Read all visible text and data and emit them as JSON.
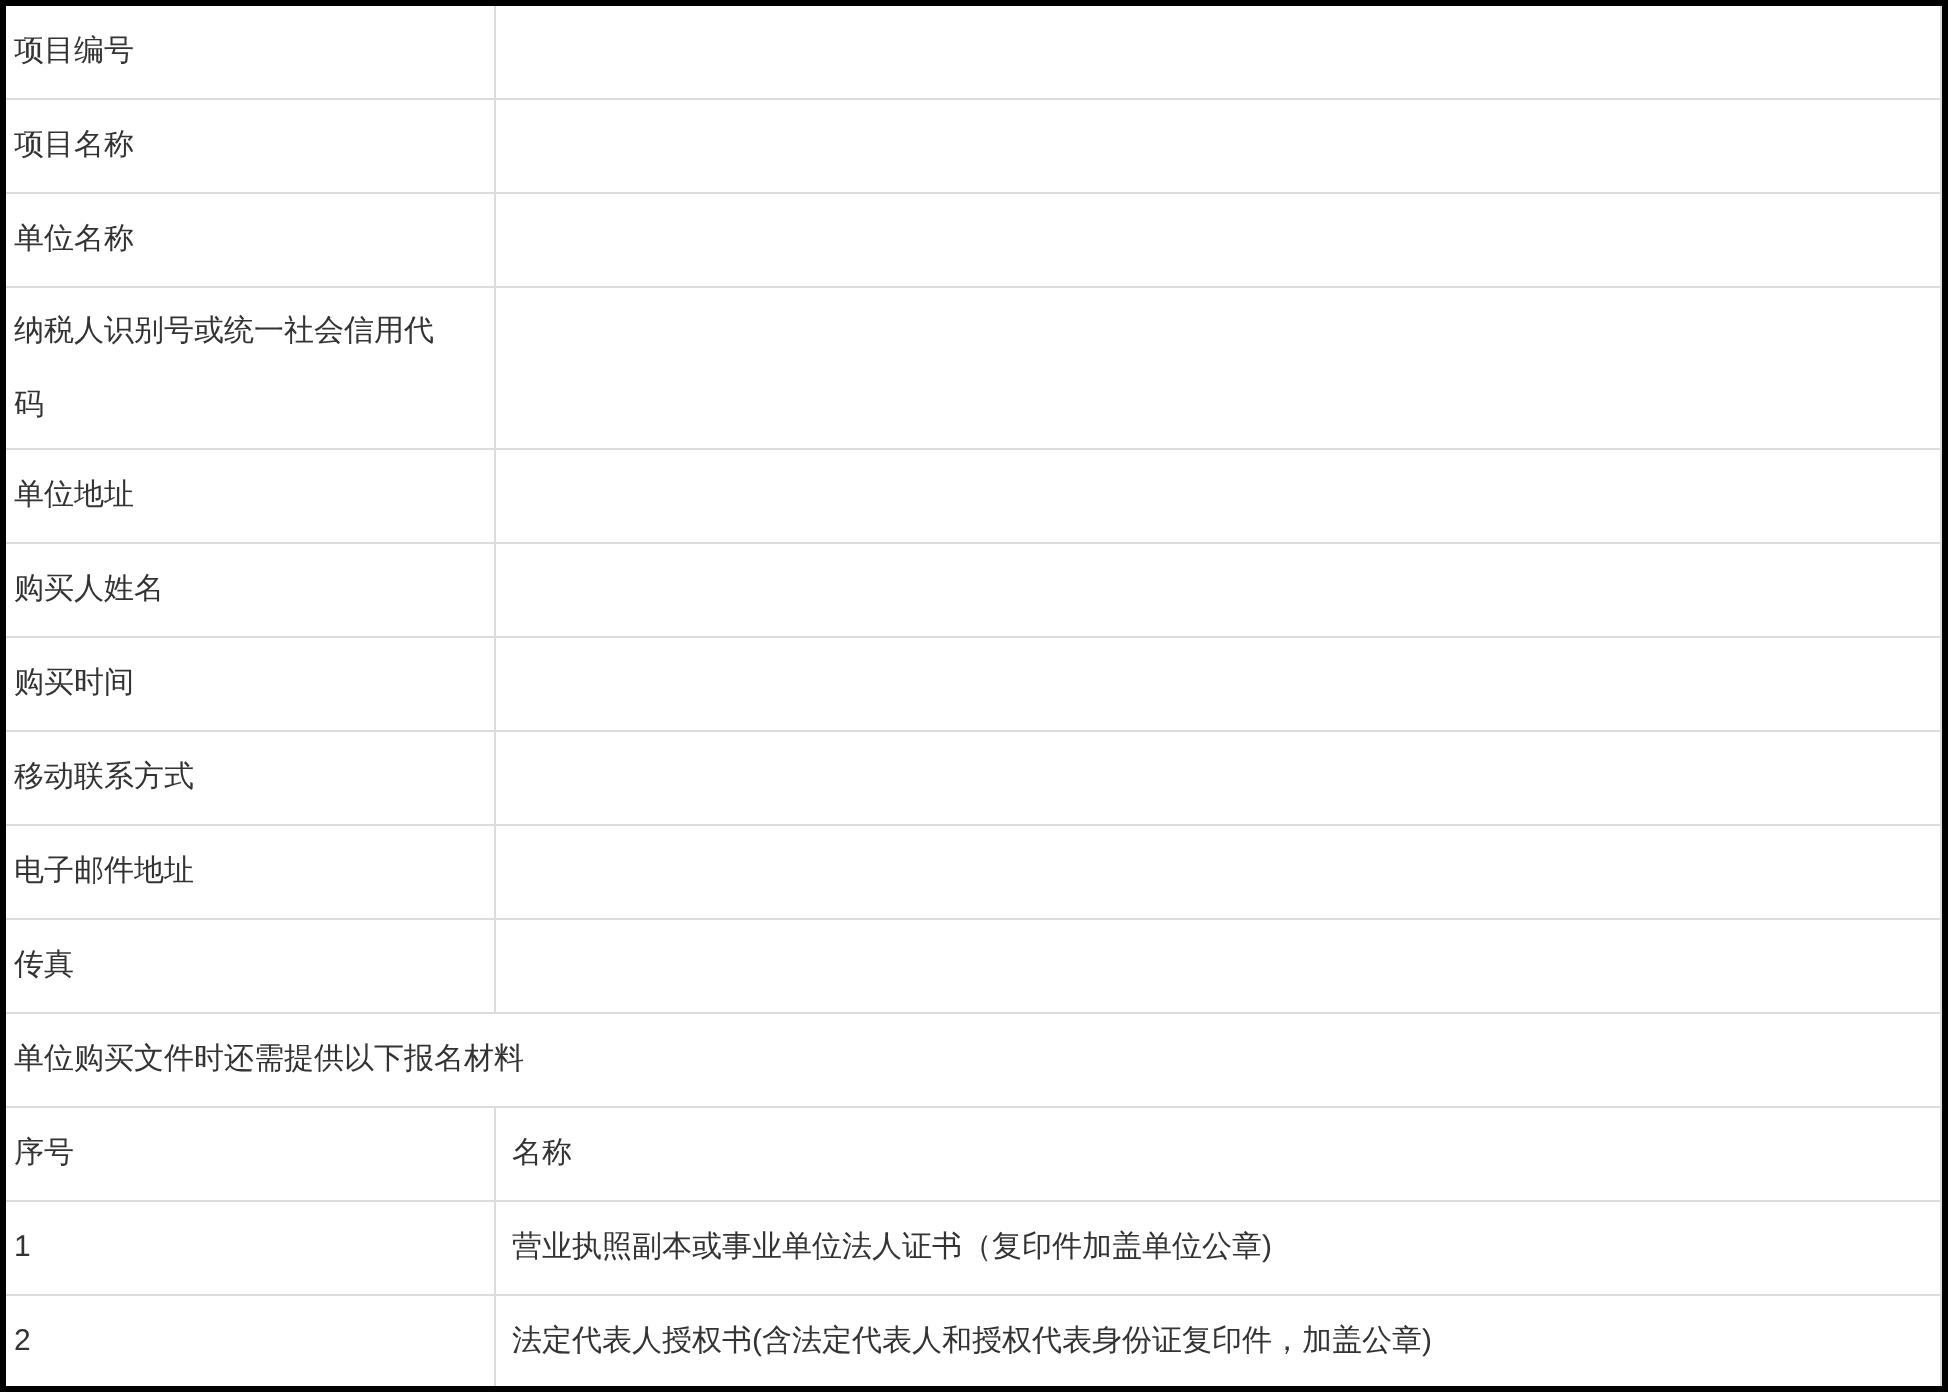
{
  "form_fields": [
    {
      "label": "项目编号"
    },
    {
      "label": "项目名称"
    },
    {
      "label": "单位名称"
    },
    {
      "label": "纳税人识别号或统一社会信用代码"
    },
    {
      "label": "单位地址"
    },
    {
      "label": "购买人姓名"
    },
    {
      "label": "购买时间"
    },
    {
      "label": "移动联系方式"
    },
    {
      "label": "电子邮件地址"
    },
    {
      "label": "传真"
    }
  ],
  "materials_note": "单位购买文件时还需提供以下报名材料",
  "materials_table": {
    "columns": [
      "序号",
      "名称"
    ],
    "rows": [
      [
        "1",
        "营业执照副本或事业单位法人证书（复印件加盖单位公章)"
      ],
      [
        "2",
        "法定代表人授权书(含法定代表人和授权代表身份证复印件，加盖公章)"
      ]
    ]
  }
}
